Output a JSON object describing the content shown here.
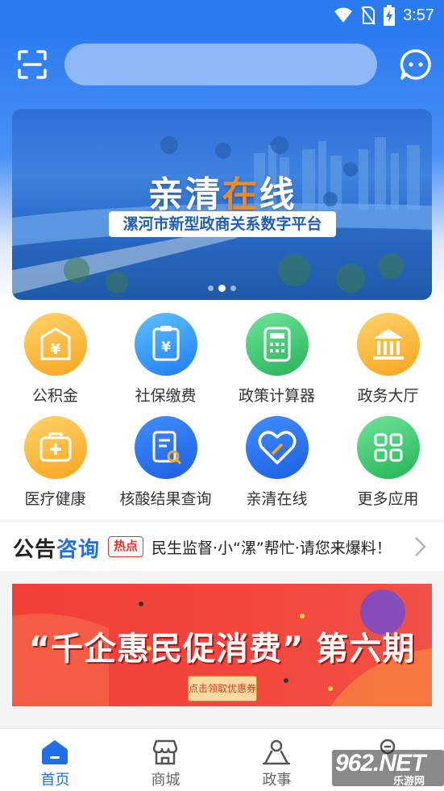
{
  "status_bar": {
    "time": "3:57",
    "icons": [
      "wifi-icon",
      "no-sim-icon",
      "battery-charging-icon"
    ]
  },
  "header": {
    "scan_icon": "scan-icon",
    "search_placeholder": "",
    "message_icon": "chat-bubble-icon",
    "accent_color": "#2b7bf0"
  },
  "banner": {
    "title_part1": "亲清",
    "title_highlight": "在",
    "title_part2": "线",
    "subtitle": "漯河市新型政商关系数字平台",
    "slide_count": 3,
    "active_slide": 2
  },
  "services": {
    "items": [
      {
        "label": "公积金",
        "icon": "housing-fund-icon",
        "color": "orange"
      },
      {
        "label": "社保缴费",
        "icon": "social-security-payment-icon",
        "color": "blue"
      },
      {
        "label": "政策计算器",
        "icon": "calculator-icon",
        "color": "green"
      },
      {
        "label": "政务大厅",
        "icon": "government-hall-icon",
        "color": "orange"
      },
      {
        "label": "医疗健康",
        "icon": "medical-kit-icon",
        "color": "orange"
      },
      {
        "label": "核酸结果查询",
        "icon": "report-search-icon",
        "color": "dblue"
      },
      {
        "label": "亲清在线",
        "icon": "heart-icon",
        "color": "dblue"
      },
      {
        "label": "更多应用",
        "icon": "apps-grid-icon",
        "color": "green"
      }
    ]
  },
  "notice": {
    "title_black": "公告",
    "title_blue": "咨询",
    "badge": "热点",
    "text": "民生监督·小“漯”帮忙·请您来爆料！"
  },
  "promo": {
    "title": "“千企惠民促消费” 第六期",
    "button": "点击领取优惠券"
  },
  "tabbar": {
    "tabs": [
      {
        "label": "首页",
        "icon": "home-icon",
        "active": true
      },
      {
        "label": "商城",
        "icon": "shop-icon",
        "active": false
      },
      {
        "label": "政事",
        "icon": "person-icon",
        "active": false
      },
      {
        "label": "",
        "icon": "profile-icon",
        "active": false
      }
    ]
  },
  "watermark": {
    "line1": "962.NET",
    "line2": "乐游网"
  }
}
